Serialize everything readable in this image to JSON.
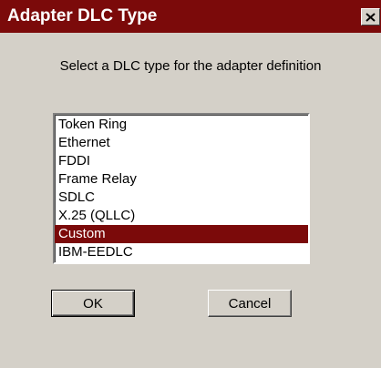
{
  "window": {
    "title": "Adapter DLC Type",
    "close_icon": "close-icon"
  },
  "dialog": {
    "prompt": "Select a DLC type for the adapter definition",
    "list_items": [
      "Token Ring",
      "Ethernet",
      "FDDI",
      "Frame Relay",
      "SDLC",
      "X.25 (QLLC)",
      "Custom",
      "IBM-EEDLC"
    ],
    "selected_item": "Custom",
    "ok_label": "OK",
    "cancel_label": "Cancel"
  },
  "colors": {
    "title_bar": "#7b0a0a",
    "selection": "#7b0a0a",
    "face": "#d4d0c8"
  }
}
